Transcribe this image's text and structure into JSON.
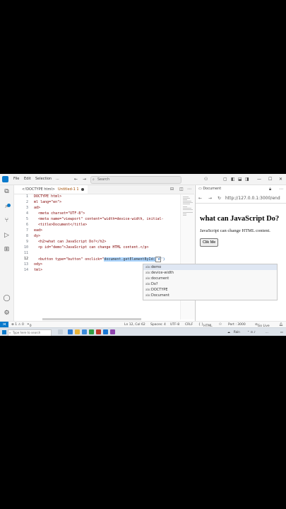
{
  "titlebar": {
    "menu": [
      "File",
      "Edit",
      "Selection",
      "..."
    ],
    "search_placeholder": "Search",
    "nav_back": "←",
    "nav_forward": "→"
  },
  "editor": {
    "breadcrumb": "<!DOCTYPE html>",
    "tab_title": "Untitled-1",
    "tab_index": "1",
    "line_numbers": [
      "1",
      "2",
      "3",
      "4",
      "5",
      "6",
      "7",
      "8",
      "9",
      "10",
      "11",
      "12",
      "13",
      "14"
    ],
    "lines": [
      "DOCTYPE html>",
      "ml lang=\"en\">",
      "ad>",
      "  <meta charset=\"UTF-8\">",
      "  <meta name=\"viewport\" content=\"width=device-width, initial-",
      "  <title>Document</title>",
      "ead>",
      "dy>",
      "  <h2>what can JavaScript Do?</h2>",
      "  <p id=\"demo\">JavaScript can change HTML content.</p>",
      "",
      "  <button type=\"button\" onclick=\"",
      "ody>",
      "tml>"
    ],
    "line12_selected": "document.getElementById(",
    "line12_after": "'d",
    "line12_end": "')"
  },
  "suggestions": [
    {
      "kind": "abc",
      "label": "demo"
    },
    {
      "kind": "abc",
      "label": "device-width"
    },
    {
      "kind": "abc",
      "label": "document"
    },
    {
      "kind": "abc",
      "label": "Do?"
    },
    {
      "kind": "abc",
      "label": "DOCTYPE"
    },
    {
      "kind": "abc",
      "label": "Document"
    }
  ],
  "browser": {
    "tab_title": "Document",
    "url": "http://127.0.0.1:3000/end",
    "heading": "what can JavaScript Do?",
    "paragraph": "JavaScript can change HTML content.",
    "button_label": "Clik Me"
  },
  "statusbar": {
    "problems": "⊗ 1 ⚠ 0",
    "ports": "0",
    "position": "Ln 12, Col 62",
    "spaces": "Spaces: 4",
    "encoding": "UTF-8",
    "eol": "CRLF",
    "language": "HTML",
    "port": "Port : 3000",
    "golive": "Go Live"
  },
  "taskbar": {
    "search_placeholder": "Type here to search",
    "weather": "Rain",
    "time": "...",
    "date": "..."
  },
  "colors": {
    "accent": "#0a7acc",
    "tag": "#800000",
    "attr": "#e50000",
    "string": "#0451a5",
    "selection": "#add6ff"
  }
}
